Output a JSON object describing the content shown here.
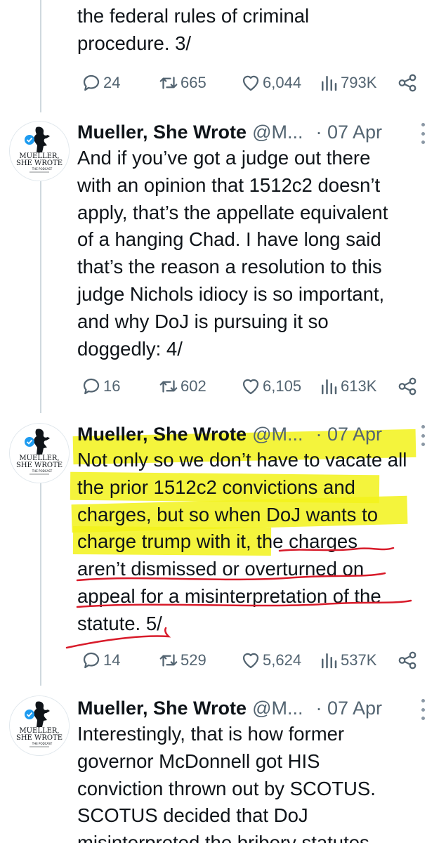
{
  "tweet0": {
    "text_lines": [
      "the federal rules of criminal",
      "procedure. 3/"
    ],
    "replies": "24",
    "retweets": "665",
    "likes": "6,044",
    "views": "793K"
  },
  "tweets": [
    {
      "name": "Mueller, She Wrote",
      "handle": "@M...",
      "date": "· 07 Apr",
      "text_lines": [
        "And if you’ve got a judge out there",
        "with an opinion that 1512c2 doesn’t",
        "apply, that’s the appellate equivalent",
        "of a hanging Chad. I have long said",
        "that’s the reason a resolution to this",
        "judge Nichols idiocy is so important,",
        "and why DoJ is pursuing it so",
        "doggedly: 4/"
      ],
      "replies": "16",
      "retweets": "602",
      "likes": "6,105",
      "views": "613K"
    },
    {
      "name": "Mueller, She Wrote",
      "handle": "@M...",
      "date": "· 07 Apr",
      "text_lines": [
        "Not only so we don’t have to vacate all",
        "the prior 1512c2 convictions and",
        "charges, but so when DoJ wants to",
        "charge trump with it, the charges",
        "aren’t dismissed or overturned on",
        "appeal for a misinterpretation of the",
        "statute. 5/"
      ],
      "replies": "14",
      "retweets": "529",
      "likes": "5,624",
      "views": "537K"
    },
    {
      "name": "Mueller, She Wrote",
      "handle": "@M...",
      "date": "· 07 Apr",
      "text_lines": [
        "Interestingly, that is how former",
        "governor McDonnell got HIS",
        "conviction thrown out by SCOTUS.",
        "SCOTUS decided that DoJ",
        "misinterpreted the bribery statutes"
      ]
    }
  ],
  "avatar": {
    "brand_line1": "MUELLER,",
    "brand_line2": "SHE WROTE",
    "brand_line3": "THE PODCAST"
  },
  "icons": [
    "reply-icon",
    "retweet-icon",
    "like-icon",
    "views-icon",
    "share-icon",
    "more-icon",
    "verified-badge-icon"
  ],
  "colors": {
    "highlight": "#f2f21a",
    "underline_ink": "#d81b2a",
    "verified": "#1d9bf0",
    "muted": "#536471"
  }
}
